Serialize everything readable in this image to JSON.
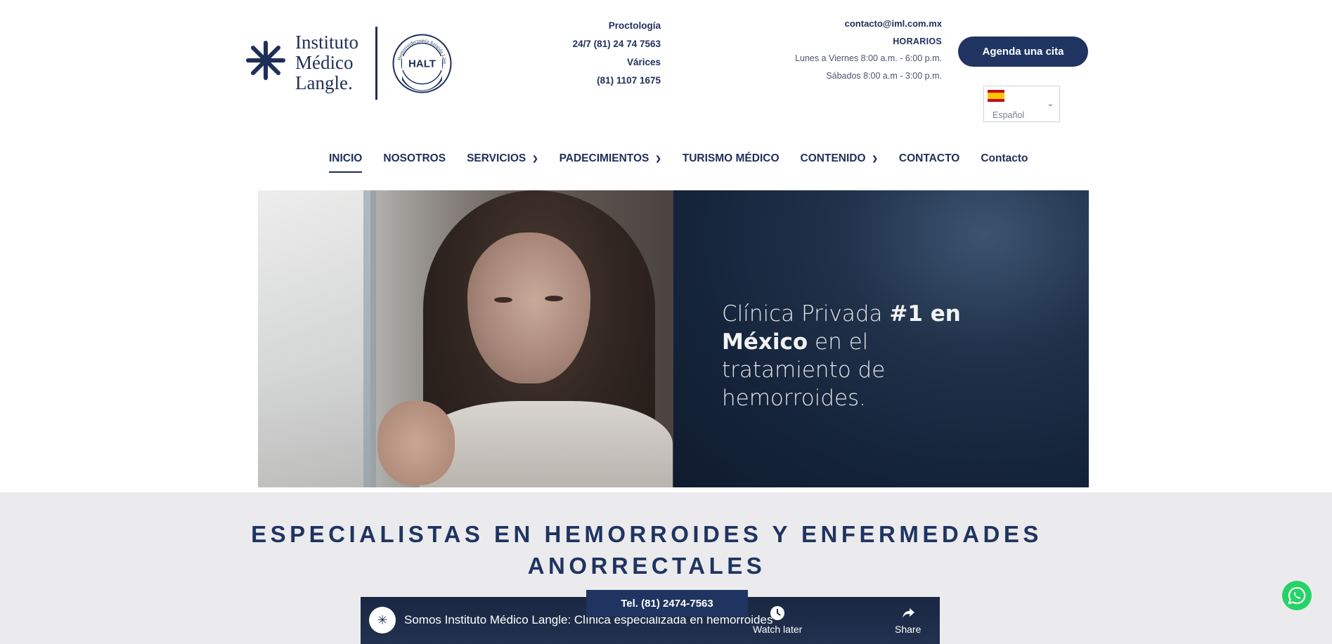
{
  "header": {
    "logo": {
      "line1": "Instituto",
      "line2": "Médico",
      "line3": "Langle.",
      "badge_text": "HALT",
      "badge_ring_text": "Hemorroidectomía Asistida Láser Térmico"
    },
    "contact_left": {
      "specialty1": "Proctología",
      "phone1": "24/7 (81) 24 74 7563",
      "specialty2": "Várices",
      "phone2": "(81) 1107 1675"
    },
    "contact_right": {
      "email": "contacto@iml.com.mx",
      "hours_title": "HORARIOS",
      "hours_weekdays": "Lunes a Viernes 8:00 a.m. - 6:00 p.m.",
      "hours_saturday": "Sábados 8:00 a.m - 3:00 p.m."
    },
    "cta_label": "Agenda una cita",
    "language": {
      "selected": "Español",
      "flag": "spain-flag-icon"
    }
  },
  "nav": {
    "items": [
      {
        "label": "INICIO",
        "active": true,
        "dropdown": false
      },
      {
        "label": "NOSOTROS",
        "active": false,
        "dropdown": false
      },
      {
        "label": "SERVICIOS",
        "active": false,
        "dropdown": true
      },
      {
        "label": "PADECIMIENTOS",
        "active": false,
        "dropdown": true
      },
      {
        "label": "TURISMO MÉDICO",
        "active": false,
        "dropdown": false
      },
      {
        "label": "CONTENIDO",
        "active": false,
        "dropdown": true
      },
      {
        "label": "CONTACTO",
        "active": false,
        "dropdown": false
      },
      {
        "label": "Contacto",
        "active": false,
        "dropdown": false
      }
    ]
  },
  "hero": {
    "text_part1": "Clínica Privada ",
    "text_bold1": "#1 en México",
    "text_part2": " en el tratamiento de hemorroides."
  },
  "section": {
    "title": "ESPECIALISTAS EN HEMORROIDES Y ENFERMEDADES ANORRECTALES"
  },
  "video": {
    "title": "Somos Instituto Médico Langle: Clínica especializada en hemorroides",
    "watch_later": "Watch later",
    "share": "Share"
  },
  "tel_bar": "Tel. (81) 2474-7563",
  "colors": {
    "brand": "#1f3461",
    "band": "#ebebed",
    "whatsapp": "#25d366"
  }
}
